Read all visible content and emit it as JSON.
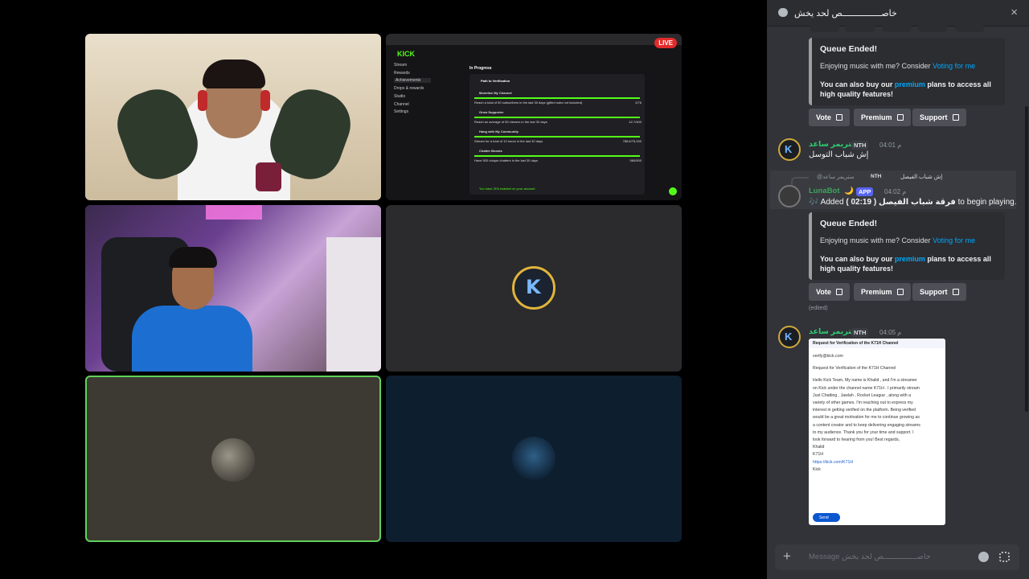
{
  "stream": {
    "live_badge": "LIVE",
    "kick_logo": "KICK",
    "sidebar": [
      "Stream",
      "Rewards",
      "Achievements",
      "Drops & rewards",
      "Studio",
      "Channel",
      "Settings"
    ],
    "panel_title": "In Progress",
    "panel_section": "Path to Verification",
    "panel_items": [
      {
        "title": "Monetize My Channel",
        "desc": "Reach a total of 50 subscribers in the last 30 days (gifted subs not included)",
        "value": "2/76"
      },
      {
        "title": "Grow Supporter",
        "desc": "Reach an average of 50 viewers in the last 30 days",
        "value": "42.7/400"
      },
      {
        "title": "Hang with My Community",
        "desc": "Stream for a total of 10 hours in the last 30 days",
        "value": "788.6/75,000"
      },
      {
        "title": "Chatter Boosts",
        "desc": "Have 500 unique chatters in the last 30 days",
        "value": "580/500"
      }
    ],
    "panel_footer": "You have 2FA enabled on your account"
  },
  "chat": {
    "title": "خاصـــــــــــــــص لحد يخش",
    "embed1": {
      "title": "Queue Ended!",
      "line1_prefix": "Enjoying music with me? Consider ",
      "line1_link": "Voting for me",
      "line2_prefix": "You can also buy our ",
      "line2_link": "premium",
      "line2_suffix": " plans to access all high quality features!"
    },
    "buttons1": {
      "vote": "Vote",
      "premium": "Premium",
      "support": "Support"
    },
    "msg1": {
      "user": "ستريمر ساعد",
      "tag": "NTH",
      "time": "04:01 م",
      "text": "إش شباب التوسل"
    },
    "reply_preview": {
      "user": "@ستريمر ساعد",
      "tag": "NTH",
      "text": "إش شباب الفيصل"
    },
    "msg2": {
      "user": "LunaBot",
      "moon": "🌙",
      "tag": "APP",
      "time": "04:02 م",
      "text_prefix": "🎶 Added ",
      "song": "( 02:19 ) فرقة شباب الفيصل",
      "text_suffix": " to begin playing."
    },
    "embed2": {
      "title": "Queue Ended!",
      "line1_prefix": "Enjoying music with me? Consider ",
      "line1_link": "Voting for me",
      "line2_prefix": "You can also buy our ",
      "line2_link": "premium",
      "line2_suffix": " plans to access all high quality features!"
    },
    "buttons2": {
      "vote": "Vote",
      "premium": "Premium",
      "support": "Support"
    },
    "edited": "(edited)",
    "msg3": {
      "user": "ستريمر ساعد",
      "tag": "NTH",
      "time": "04:05 م"
    },
    "email": {
      "subject": "Request for Verification of the K71H Channel",
      "to": "verify@kick.com",
      "subject_line": "Request for Verification of the K71H Channel",
      "body": [
        "Hello Kick Team, My name is Khalid , and I'm a streamer",
        "on Kick under the channel name K71H . I primarily stream",
        "Just Chatting , Jawlah , Rocket League , along with a",
        "variety of other games. I'm reaching out to express my",
        "interest in getting verified on the platform. Being verified",
        "would be a great motivation for me to continue growing as",
        "a content creator and to keep delivering engaging streams",
        "to my audience. Thank you for your time and support. I",
        "look forward to hearing from you! Best regards,",
        "Khalid",
        "K71H",
        "https://kick.com/K71H",
        "Kick"
      ],
      "send": "Send"
    },
    "composer_placeholder": "Message خاصـــــــــــــــص لحد يخش"
  }
}
